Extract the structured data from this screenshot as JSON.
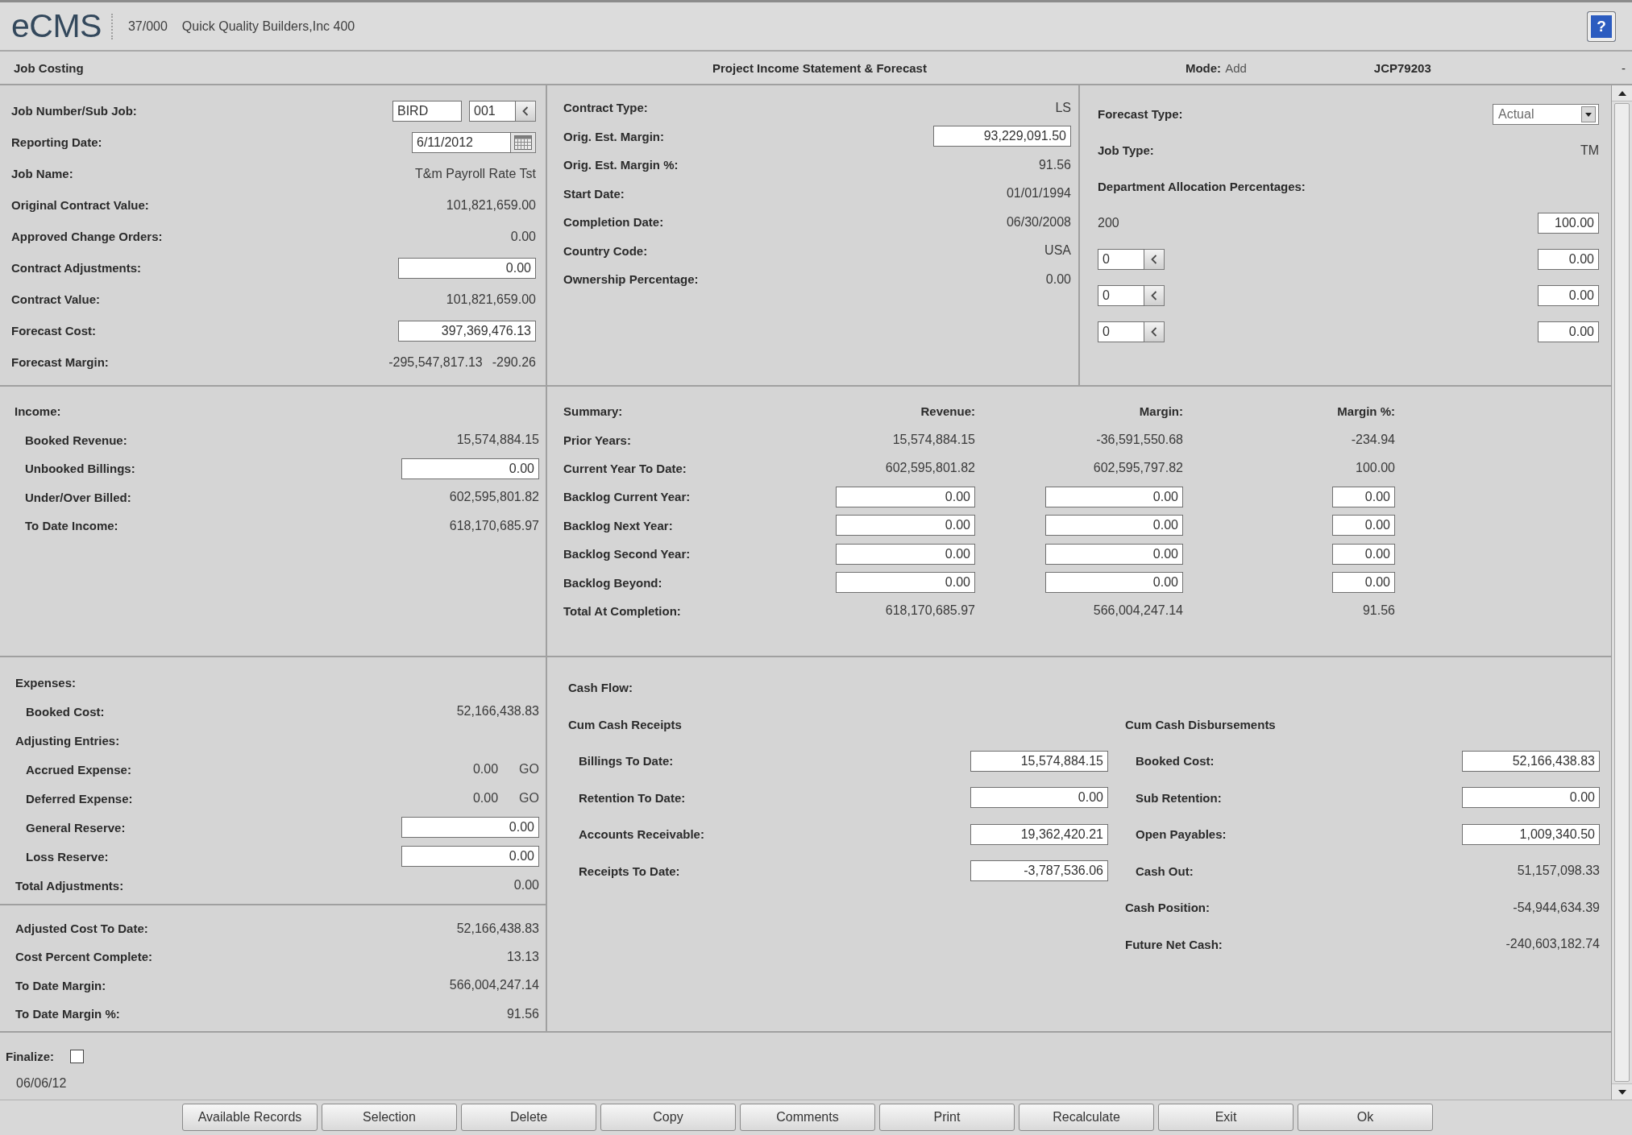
{
  "header": {
    "logo": "eCMS",
    "company_code": "37/000",
    "company_name": "Quick Quality Builders,Inc 400",
    "help_button": "?"
  },
  "title_bar": {
    "module": "Job Costing",
    "title": "Project Income Statement & Forecast",
    "mode_label": "Mode:",
    "mode": "Add",
    "program": "JCP79203",
    "corner": "-"
  },
  "job": {
    "rows": [
      {
        "kind": "job",
        "label": "Job Number/Sub Job:",
        "job": "BIRD",
        "sub_job": "001"
      },
      {
        "kind": "date",
        "label": "Reporting Date:",
        "value": "6/11/2012"
      },
      {
        "kind": "text",
        "label": "Job Name:",
        "value": "T&m Payroll Rate Tst"
      },
      {
        "kind": "text",
        "label": "Original Contract Value:",
        "value": "101,821,659.00"
      },
      {
        "kind": "text",
        "label": "Approved Change Orders:",
        "value": "0.00"
      },
      {
        "kind": "input",
        "label": "Contract Adjustments:",
        "value": "0.00"
      },
      {
        "kind": "text",
        "label": "Contract Value:",
        "value": "101,821,659.00"
      },
      {
        "kind": "input",
        "label": "Forecast Cost:",
        "value": "397,369,476.13"
      },
      {
        "kind": "pair",
        "label": "Forecast Margin:",
        "value": "-295,547,817.13",
        "percent": "-290.26"
      }
    ]
  },
  "contract": {
    "rows": [
      {
        "kind": "text",
        "label": "Contract Type:",
        "value": "LS"
      },
      {
        "kind": "input",
        "label": "Orig. Est. Margin:",
        "value": "93,229,091.50"
      },
      {
        "kind": "text",
        "label": "Orig. Est. Margin %:",
        "value": "91.56"
      },
      {
        "kind": "text",
        "label": "Start Date:",
        "value": "01/01/1994"
      },
      {
        "kind": "text",
        "label": "Completion Date:",
        "value": "06/30/2008"
      },
      {
        "kind": "text",
        "label": "Country Code:",
        "value": "USA"
      },
      {
        "kind": "text",
        "label": "Ownership Percentage:",
        "value": "0.00"
      }
    ]
  },
  "forecast": {
    "type_label": "Forecast Type:",
    "type": "Actual",
    "job_type_label": "Job Type:",
    "job_type": "TM",
    "allocation_label": "Department Allocation Percentages:",
    "allocations": [
      {
        "kind": "fixed",
        "department": "200",
        "percent": "100.00"
      },
      {
        "kind": "lookup",
        "department": "0",
        "percent": "0.00"
      },
      {
        "kind": "lookup",
        "department": "0",
        "percent": "0.00"
      },
      {
        "kind": "lookup",
        "department": "0",
        "percent": "0.00"
      }
    ]
  },
  "income": {
    "items": [
      {
        "kind": "heading",
        "label": "Income:",
        "children": [
          {
            "kind": "text",
            "label": "Booked Revenue:",
            "value": "15,574,884.15"
          },
          {
            "kind": "input",
            "label": "Unbooked Billings:",
            "value": "0.00"
          },
          {
            "kind": "text",
            "label": "Under/Over Billed:",
            "value": "602,595,801.82"
          },
          {
            "kind": "text",
            "label": "To Date Income:",
            "value": "618,170,685.97"
          }
        ]
      }
    ]
  },
  "summary": {
    "title": "Summary:",
    "columns": [
      "Revenue:",
      "Margin:",
      "Margin %:"
    ],
    "rows": [
      {
        "kind": "text",
        "label": "Prior Years:",
        "values": [
          "15,574,884.15",
          "-36,591,550.68",
          "-234.94"
        ]
      },
      {
        "kind": "text",
        "label": "Current Year To Date:",
        "values": [
          "602,595,801.82",
          "602,595,797.82",
          "100.00"
        ]
      },
      {
        "kind": "input",
        "label": "Backlog Current Year:",
        "values": [
          "0.00",
          "0.00",
          "0.00"
        ]
      },
      {
        "kind": "input",
        "label": "Backlog Next Year:",
        "values": [
          "0.00",
          "0.00",
          "0.00"
        ]
      },
      {
        "kind": "input",
        "label": "Backlog Second Year:",
        "values": [
          "0.00",
          "0.00",
          "0.00"
        ]
      },
      {
        "kind": "input",
        "label": "Backlog Beyond:",
        "values": [
          "0.00",
          "0.00",
          "0.00"
        ]
      },
      {
        "kind": "text",
        "label": "Total At Completion:",
        "values": [
          "618,170,685.97",
          "566,004,247.14",
          "91.56"
        ]
      }
    ]
  },
  "expenses": {
    "items": [
      {
        "kind": "heading",
        "label": "Expenses:",
        "children": [
          {
            "kind": "text",
            "label": "Booked Cost:",
            "value": "52,166,438.83"
          }
        ]
      },
      {
        "kind": "heading",
        "label": "Adjusting Entries:",
        "children": [
          {
            "kind": "go",
            "label": "Accrued Expense:",
            "value": "0.00",
            "link": "GO"
          },
          {
            "kind": "go",
            "label": "Deferred Expense:",
            "value": "0.00",
            "link": "GO"
          },
          {
            "kind": "input",
            "label": "General Reserve:",
            "value": "0.00"
          },
          {
            "kind": "input",
            "label": "Loss Reserve:",
            "value": "0.00"
          }
        ]
      },
      {
        "kind": "text",
        "label": "Total Adjustments:",
        "value": "0.00"
      }
    ]
  },
  "totals": {
    "rows": [
      {
        "kind": "text",
        "label": "Adjusted Cost To Date:",
        "value": "52,166,438.83"
      },
      {
        "kind": "text",
        "label": "Cost Percent Complete:",
        "value": "13.13"
      },
      {
        "kind": "text",
        "label": "To Date Margin:",
        "value": "566,004,247.14"
      },
      {
        "kind": "text",
        "label": "To Date Margin %:",
        "value": "91.56"
      }
    ]
  },
  "cash_flow": {
    "title": "Cash Flow:",
    "receipts": [
      {
        "kind": "heading",
        "label": "Cum Cash Receipts",
        "children": [
          {
            "kind": "input",
            "label": "Billings To Date:",
            "value": "15,574,884.15"
          },
          {
            "kind": "input",
            "label": "Retention To Date:",
            "value": "0.00"
          },
          {
            "kind": "input",
            "label": "Accounts Receivable:",
            "value": "19,362,420.21"
          },
          {
            "kind": "input",
            "label": "Receipts To Date:",
            "value": "-3,787,536.06"
          }
        ]
      }
    ],
    "disbursements": [
      {
        "kind": "heading",
        "label": "Cum Cash Disbursements",
        "children": [
          {
            "kind": "input",
            "label": "Booked Cost:",
            "value": "52,166,438.83"
          },
          {
            "kind": "input",
            "label": "Sub Retention:",
            "value": "0.00"
          },
          {
            "kind": "input",
            "label": "Open Payables:",
            "value": "1,009,340.50"
          },
          {
            "kind": "text",
            "label": "Cash Out:",
            "value": "51,157,098.33"
          }
        ]
      },
      {
        "kind": "text",
        "label": "Cash Position:",
        "value": "-54,944,634.39"
      },
      {
        "kind": "text",
        "label": "Future Net Cash:",
        "value": "-240,603,182.74"
      }
    ]
  },
  "footer": {
    "finalize_label": "Finalize:",
    "finalize_checked": false,
    "date": "06/06/12"
  },
  "buttons": [
    "Available Records",
    "Selection",
    "Delete",
    "Copy",
    "Comments",
    "Print",
    "Recalculate",
    "Exit",
    "Ok"
  ]
}
